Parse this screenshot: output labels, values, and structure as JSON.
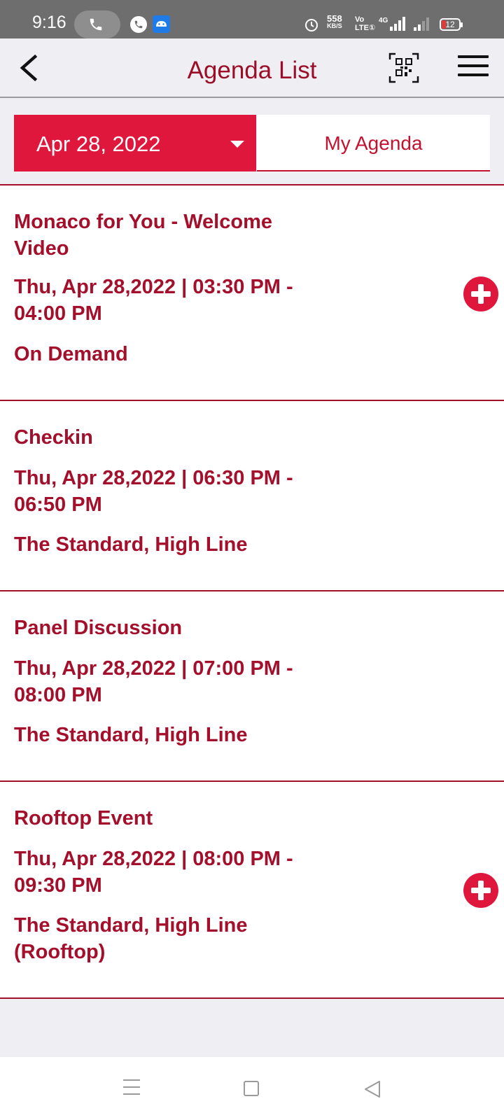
{
  "status_bar": {
    "time": "9:16",
    "speed_value": "558",
    "speed_unit": "KB/S",
    "volte_top": "Vo",
    "volte_bottom": "LTE①",
    "network_label": "4G",
    "battery": "12"
  },
  "header": {
    "title": "Agenda List"
  },
  "tabs": {
    "date": "Apr 28, 2022",
    "my_agenda": "My Agenda"
  },
  "agenda": [
    {
      "title": "Monaco for You - Welcome Video",
      "time": "Thu, Apr 28,2022 | 03:30 PM - 04:00 PM",
      "location": "On Demand",
      "has_add": true
    },
    {
      "title": "Checkin",
      "time": "Thu, Apr 28,2022 | 06:30 PM - 06:50 PM",
      "location": "The Standard, High Line",
      "has_add": false
    },
    {
      "title": "Panel Discussion",
      "time": "Thu, Apr 28,2022 | 07:00 PM - 08:00 PM",
      "location": "The Standard, High Line",
      "has_add": false
    },
    {
      "title": "Rooftop Event",
      "time": "Thu, Apr 28,2022 | 08:00 PM - 09:30 PM",
      "location": "The Standard, High Line (Rooftop)",
      "has_add": true
    }
  ],
  "colors": {
    "accent": "#e0173d",
    "text_dark_red": "#a40f2c",
    "status_bar": "#6e6e6e",
    "background": "#efeef3"
  }
}
